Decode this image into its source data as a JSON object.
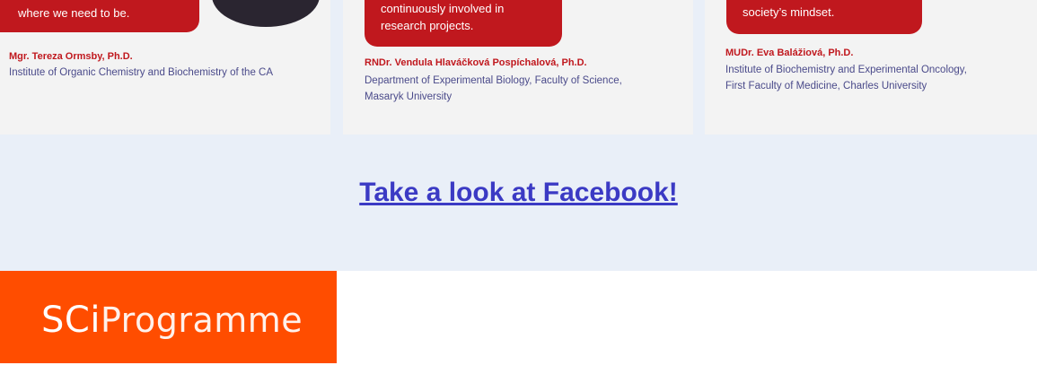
{
  "cards": [
    {
      "quote": "where we need to be.",
      "name": "Mgr. Tereza Ormsby, Ph.D.",
      "affiliation": [
        "Institute of Organic Chemistry and Biochemistry of the CA"
      ]
    },
    {
      "quote_lines": [
        "continuously involved in",
        "research projects."
      ],
      "name": "RNDr. Vendula Hlaváčková Pospíchalová, Ph.D.",
      "affiliation": [
        "Department of Experimental Biology, Faculty of Science,",
        "Masaryk University"
      ]
    },
    {
      "quote": "society’s mindset.",
      "name": "MUDr. Eva Balážiová, Ph.D.",
      "affiliation": [
        "Institute of Biochemistry and Experimental Oncology,",
        "First Faculty of Medicine, Charles University"
      ]
    }
  ],
  "facebook_link": "Take a look at Facebook!",
  "logo": {
    "sci": "SCi",
    "programme": "Programme"
  },
  "colors": {
    "accent_red": "#c0181e",
    "link_blue": "#3b3ac4",
    "brand_orange": "#ff4d00",
    "band_bg": "#e9eff8"
  }
}
